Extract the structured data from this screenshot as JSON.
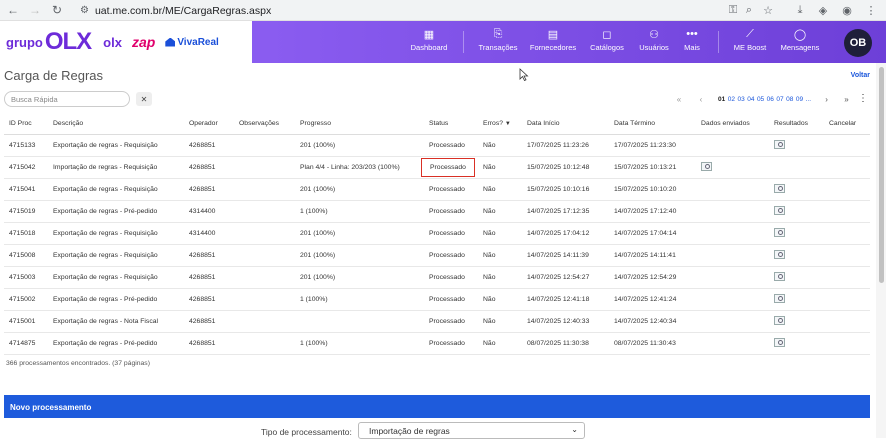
{
  "browser": {
    "url": "uat.me.com.br/ME/CargaRegras.aspx"
  },
  "header": {
    "brand": {
      "grupo": "grupo",
      "olx": "OLX",
      "olx_small": "olx",
      "zap": "zap",
      "vivareal": "VivaReal"
    },
    "nav": [
      {
        "label": "Dashboard",
        "icon": "dashboard-icon"
      },
      {
        "label": "Transações",
        "icon": "transactions-icon"
      },
      {
        "label": "Fornecedores",
        "icon": "suppliers-icon"
      },
      {
        "label": "Catálogos",
        "icon": "catalogs-icon"
      },
      {
        "label": "Usuários",
        "icon": "users-icon"
      },
      {
        "label": "Mais",
        "icon": "more-icon"
      },
      {
        "label": "ME Boost",
        "icon": "chart-icon"
      },
      {
        "label": "Mensagens",
        "icon": "messages-icon"
      }
    ],
    "avatar": "OB"
  },
  "page": {
    "title": "Carga de Regras",
    "voltar": "Voltar",
    "search_placeholder": "Busca Rápida",
    "clear": "✕"
  },
  "pager": {
    "pages": [
      "01",
      "02",
      "03",
      "04",
      "05",
      "06",
      "07",
      "08",
      "09"
    ],
    "current": "01",
    "ellipsis": "..."
  },
  "table": {
    "columns": [
      "ID Proc",
      "Descrição",
      "Operador",
      "Observações",
      "Progresso",
      "Status",
      "Erros?",
      "Data Início",
      "Data Término",
      "Dados enviados",
      "Resultados",
      "Cancelar"
    ],
    "rows": [
      {
        "id": "4715133",
        "desc": "Exportação de regras - Requisição",
        "op": "4268851",
        "obs": "",
        "prog": "201 (100%)",
        "status": "Processado",
        "err": "Não",
        "ini": "17/07/2025 11:23:26",
        "fim": "17/07/2025 11:23:30",
        "sent": false,
        "res": true
      },
      {
        "id": "4715042",
        "desc": "Importação de regras - Requisição",
        "op": "4268851",
        "obs": "",
        "prog": "Plan 4/4 - Linha: 203/203 (100%)",
        "status": "Processado",
        "err": "Não",
        "ini": "15/07/2025 10:12:48",
        "fim": "15/07/2025 10:13:21",
        "sent": true,
        "res": false
      },
      {
        "id": "4715041",
        "desc": "Exportação de regras - Requisição",
        "op": "4268851",
        "obs": "",
        "prog": "201 (100%)",
        "status": "Processado",
        "err": "Não",
        "ini": "15/07/2025 10:10:16",
        "fim": "15/07/2025 10:10:20",
        "sent": false,
        "res": true
      },
      {
        "id": "4715019",
        "desc": "Exportação de regras - Pré-pedido",
        "op": "4314400",
        "obs": "",
        "prog": "1 (100%)",
        "status": "Processado",
        "err": "Não",
        "ini": "14/07/2025 17:12:35",
        "fim": "14/07/2025 17:12:40",
        "sent": false,
        "res": true
      },
      {
        "id": "4715018",
        "desc": "Exportação de regras - Requisição",
        "op": "4314400",
        "obs": "",
        "prog": "201 (100%)",
        "status": "Processado",
        "err": "Não",
        "ini": "14/07/2025 17:04:12",
        "fim": "14/07/2025 17:04:14",
        "sent": false,
        "res": true
      },
      {
        "id": "4715008",
        "desc": "Exportação de regras - Requisição",
        "op": "4268851",
        "obs": "",
        "prog": "201 (100%)",
        "status": "Processado",
        "err": "Não",
        "ini": "14/07/2025 14:11:39",
        "fim": "14/07/2025 14:11:41",
        "sent": false,
        "res": true
      },
      {
        "id": "4715003",
        "desc": "Exportação de regras - Requisição",
        "op": "4268851",
        "obs": "",
        "prog": "201 (100%)",
        "status": "Processado",
        "err": "Não",
        "ini": "14/07/2025 12:54:27",
        "fim": "14/07/2025 12:54:29",
        "sent": false,
        "res": true
      },
      {
        "id": "4715002",
        "desc": "Exportação de regras - Pré-pedido",
        "op": "4268851",
        "obs": "",
        "prog": "1 (100%)",
        "status": "Processado",
        "err": "Não",
        "ini": "14/07/2025 12:41:18",
        "fim": "14/07/2025 12:41:24",
        "sent": false,
        "res": true
      },
      {
        "id": "4715001",
        "desc": "Exportação de regras - Nota Fiscal",
        "op": "4268851",
        "obs": "",
        "prog": "",
        "status": "Processado",
        "err": "Não",
        "ini": "14/07/2025 12:40:33",
        "fim": "14/07/2025 12:40:34",
        "sent": false,
        "res": true
      },
      {
        "id": "4714875",
        "desc": "Exportação de regras - Pré-pedido",
        "op": "4268851",
        "obs": "",
        "prog": "1 (100%)",
        "status": "Processado",
        "err": "Não",
        "ini": "08/07/2025 11:30:38",
        "fim": "08/07/2025 11:30:43",
        "sent": false,
        "res": true
      }
    ]
  },
  "footer": {
    "count": "366 processamentos encontrados. (37 páginas)"
  },
  "novo": {
    "title": "Novo processamento",
    "tipo_label": "Tipo de processamento:",
    "tipo_value": "Importação de regras"
  },
  "colors": {
    "accent": "#7b52e6",
    "link": "#1a56db",
    "novo_bar": "#1e5bdc",
    "highlight": "#d93025"
  }
}
